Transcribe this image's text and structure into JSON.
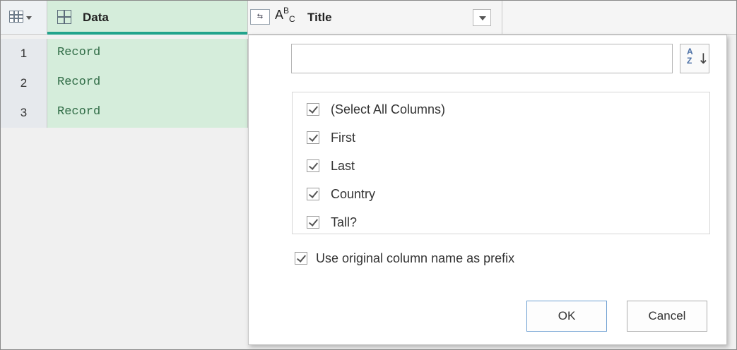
{
  "grid": {
    "columns": [
      {
        "name": "Data",
        "type_icon": "table-icon"
      },
      {
        "name": "Title",
        "type_icon": "abc-text-icon"
      }
    ],
    "rows": [
      {
        "index": "1",
        "value": "Record"
      },
      {
        "index": "2",
        "value": "Record"
      },
      {
        "index": "3",
        "value": "Record"
      }
    ]
  },
  "expand_panel": {
    "search_value": "",
    "sort_icon": "sort-az-icon",
    "items": [
      {
        "label": "(Select All Columns)",
        "checked": true
      },
      {
        "label": "First",
        "checked": true
      },
      {
        "label": "Last",
        "checked": true
      },
      {
        "label": "Country",
        "checked": true
      },
      {
        "label": "Tall?",
        "checked": true
      }
    ],
    "prefix_label": "Use original column name as prefix",
    "prefix_checked": true,
    "ok_label": "OK",
    "cancel_label": "Cancel"
  },
  "colors": {
    "data_column_bg": "#d5eddb",
    "accent": "#21a38c",
    "record_text": "#2f6b45"
  }
}
